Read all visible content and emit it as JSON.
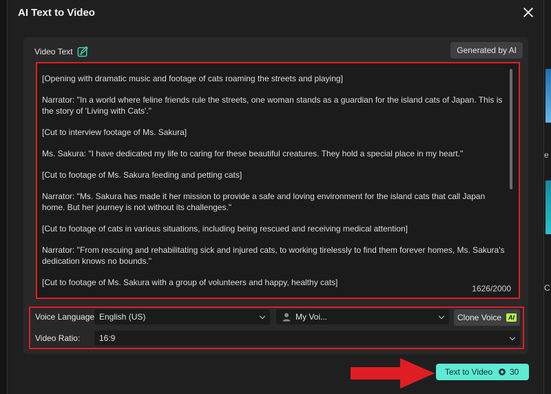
{
  "dialog": {
    "title": "AI Text to Video",
    "close_icon": "close-icon"
  },
  "video_text": {
    "label": "Video Text",
    "label_icon": "edit-icon",
    "generated_button": "Generated by AI",
    "paragraphs": [
      "[Opening with dramatic music and footage of cats roaming the streets and playing]",
      "Narrator: \"In a world where feline friends rule the streets, one woman stands as a guardian for the island cats of Japan. This is the story of 'Living with Cats'.\"",
      "[Cut to interview footage of Ms. Sakura]",
      "Ms. Sakura: \"I have dedicated my life to caring for these beautiful creatures. They hold a special place in my heart.\"",
      "[Cut to footage of Ms. Sakura feeding and petting cats]",
      "Narrator: \"Ms. Sakura has made it her mission to provide a safe and loving environment for the island cats that call Japan home. But her journey is not without its challenges.\"",
      "[Cut to footage of cats in various situations, including being rescued and receiving medical attention]",
      "Narrator: \"From rescuing and rehabilitating sick and injured cats, to working tirelessly to find them forever homes, Ms. Sakura's dedication knows no bounds.\"",
      "[Cut to footage of Ms. Sakura with a group of volunteers and happy, healthy cats]"
    ],
    "char_count": "1626/2000"
  },
  "options": {
    "voice_language_label": "Voice Language:",
    "voice_language_value": "English (US)",
    "voice_value": "My Voi...",
    "voice_icon": "person-icon",
    "clone_voice_label": "Clone Voice",
    "clone_voice_badge": "AI",
    "video_ratio_label": "Video Ratio:",
    "video_ratio_value": "16:9"
  },
  "action": {
    "text_to_video_label": "Text to Video",
    "credits": "30",
    "credit_icon": "credit-icon"
  },
  "background": {
    "letter_1": "e",
    "letter_2": "C"
  },
  "colors": {
    "accent": "#5eead4",
    "highlight_border": "#e11d24",
    "ai_badge": "#b8f24a",
    "edit_icon": "#41d1a9"
  }
}
